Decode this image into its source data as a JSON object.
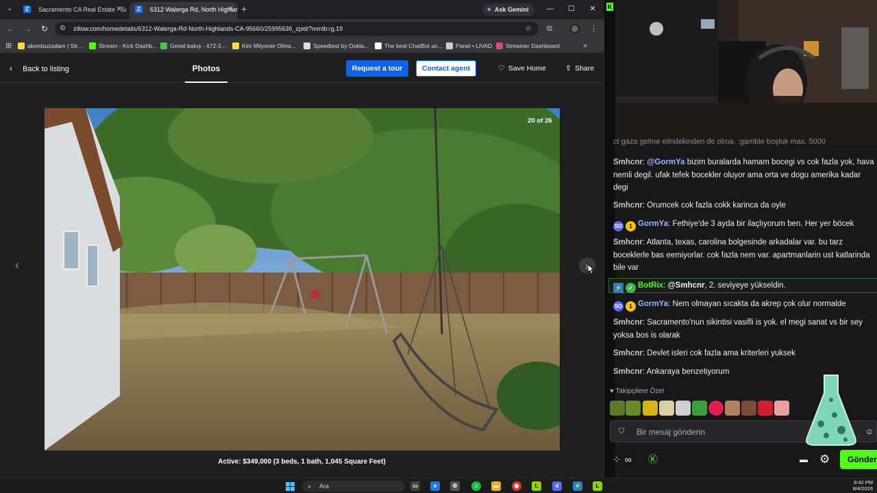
{
  "browser": {
    "tabs": [
      {
        "title": "Sacramento CA Real Estate - Sacramento CA Homes For Sale | Zillow",
        "active": false
      },
      {
        "title": "6312 Walerga Rd, North Highlands, CA 95660 | Zillow",
        "active": true
      }
    ],
    "ask_gemini": "Ask Gemini",
    "url": "zillow.com/homedetails/6312-Walerga-Rd-North-Highlands-CA-95660/25995636_zpid/?mmlb=g,19",
    "bookmarks": [
      {
        "label": "akordsuzadam | Str...",
        "color": "#ffd84a"
      },
      {
        "label": "Stream - Kick Dashb...",
        "color": "#53fc18"
      },
      {
        "label": "Genel bakış - 472-3...",
        "color": "#4cc24c"
      },
      {
        "label": "Kim Milyoner Olma...",
        "color": "#ffd84a"
      },
      {
        "label": "Speedtest by Ookla...",
        "color": "#dddddd"
      },
      {
        "label": "The best ChatBot an...",
        "color": "#ffffff"
      },
      {
        "label": "Panel • LIVAD",
        "color": "#cccccc"
      },
      {
        "label": "Streamer Dashboard",
        "color": "#e0457b"
      }
    ]
  },
  "zillow": {
    "back_label": "Back to listing",
    "photos_label": "Photos",
    "request_tour_label": "Request a tour",
    "contact_agent_label": "Contact agent",
    "save_home_label": "Save Home",
    "share_label": "Share",
    "photo_counter": "20 of 26",
    "caption": "Active: $349,000 (3 beds, 1 bath, 1,045 Square Feet)"
  },
  "chat": {
    "partial_top": "ct gaza gelme elindekinden de olma. :gamble boşluk max. 5000",
    "messages": [
      {
        "user": "Smhcnr",
        "mention": "@GormYa",
        "text": " bizim buralarda hamam bocegi vs cok fazla yok, hava nemli degil. ufak tefek bocekler oluyor ama orta ve dogu amerika kadar degi"
      },
      {
        "user": "Smhcnr",
        "mention": "",
        "text": " Orumcek cok fazla cokk karinca da oyle"
      },
      {
        "user": "GormYa",
        "mention": "",
        "text": " Fethiye'de 3 ayda bir ilaçlıyorum ben. Her yer böcek"
      },
      {
        "user": "Smhcnr",
        "mention": "",
        "text": " Atlanta, texas, carolina bolgesinde arkadalar var. bu tarz boceklerle bas eemiyorlar. cok fazla nem var. apartmanlarin ust katlarinda bile var"
      },
      {
        "user": "BotRix",
        "mention": "@Smhcnr",
        "text": ", 2. seviyeye yükseldin."
      },
      {
        "user": "GormYa",
        "mention": "",
        "text": " Nem olmayan sıcakta da akrep çok olur normalde"
      },
      {
        "user": "Smhcnr",
        "mention": "",
        "text": " Sacramento'nun sikintisi vasifli is yok. el megi sanat vs bir sey yoksa bos is olarak"
      },
      {
        "user": "Smhcnr",
        "mention": "",
        "text": " Devlet isleri cok fazla ama kriterleri yuksek"
      },
      {
        "user": "Smhcnr",
        "mention": "",
        "text": " Ankaraya benzetiyorum"
      }
    ],
    "badges": {
      "sub": "SO",
      "gold": "1"
    },
    "followers_only_label": "Takipçilere Özel",
    "message_placeholder": "Bir mesaj gönderin",
    "send_label": "Gönder"
  },
  "taskbar": {
    "search_placeholder": "Ara",
    "time": "9:42 PM",
    "date": "8/4/2026"
  }
}
